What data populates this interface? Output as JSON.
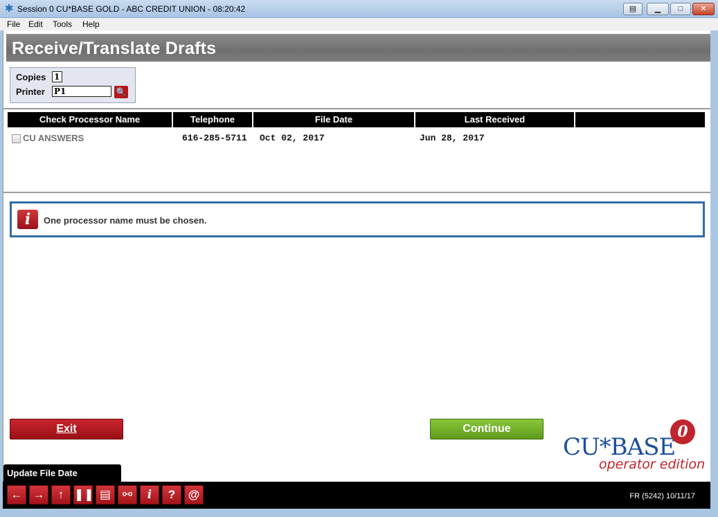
{
  "window": {
    "title": "Session 0 CU*BASE GOLD - ABC CREDIT UNION - 08:20:42",
    "icon": "app-star-icon"
  },
  "menu": [
    "File",
    "Edit",
    "Tools",
    "Help"
  ],
  "page": {
    "title": "Receive/Translate Drafts"
  },
  "options": {
    "copies_label": "Copies",
    "copies_value": "1",
    "printer_label": "Printer",
    "printer_value": "P1"
  },
  "grid": {
    "columns": [
      "Check Processor Name",
      "Telephone",
      "File Date",
      "Last Received",
      ""
    ],
    "rows": [
      {
        "name": "CU ANSWERS",
        "telephone": "616-285-5711",
        "file_date": "Oct 02, 2017",
        "last_received": "Jun 28, 2017"
      }
    ]
  },
  "message": {
    "text": "One processor name must be chosen.",
    "icon": "info-icon"
  },
  "buttons": {
    "exit": "Exit",
    "continue": "Continue"
  },
  "logo": {
    "main": "CU*BASE",
    "sub": "operator edition",
    "badge": "0"
  },
  "tab": {
    "label": "Update File Date"
  },
  "toolbar": {
    "icons": [
      "back-arrow-icon",
      "forward-arrow-icon",
      "up-arrow-icon",
      "pause-icon",
      "print-icon",
      "link-icon",
      "info-icon",
      "help-icon",
      "email-icon"
    ],
    "status": "FR (5242) 10/11/17"
  },
  "colors": {
    "accent_red": "#b3181e",
    "accent_green": "#6cae2a",
    "message_border": "#2f6ca5"
  }
}
